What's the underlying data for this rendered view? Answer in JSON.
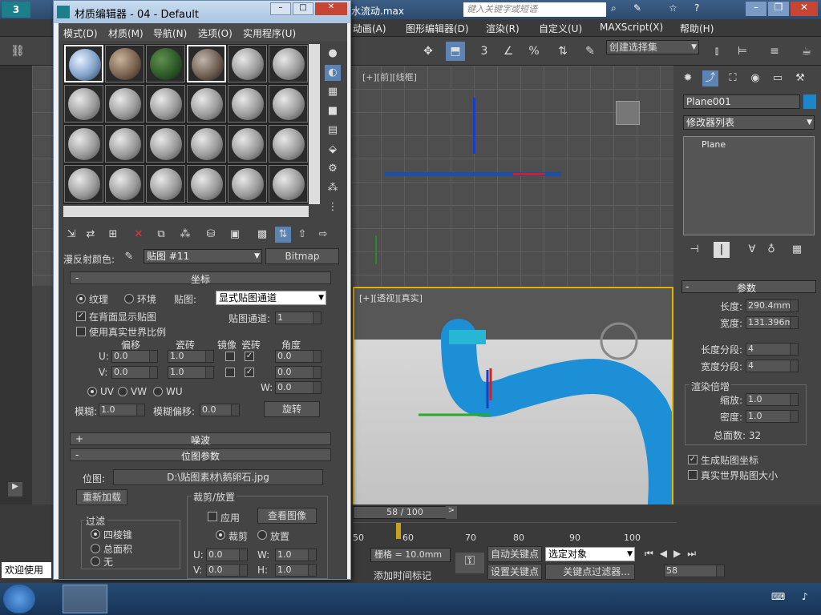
{
  "app": {
    "filename": "水流动.max",
    "search_placeholder": "键入关键字或短语",
    "menu": [
      "动画(A)",
      "图形编辑器(D)",
      "渲染(R)",
      "自定义(U)",
      "MAXScript(X)",
      "帮助(H)"
    ],
    "selection_set": "创建选择集"
  },
  "viewports": {
    "top_label": "[+][前][线框]",
    "persp_label": "[+][透视][真实]"
  },
  "cmdpanel": {
    "object_name": "Plane001",
    "modifier_list": "修改器列表",
    "stack_item": "Plane",
    "params_title": "参数",
    "length_label": "长度:",
    "length_value": "290.4mm",
    "width_label": "宽度:",
    "width_value": "131.396m",
    "length_segs_label": "长度分段:",
    "length_segs_value": "4",
    "width_segs_label": "宽度分段:",
    "width_segs_value": "4",
    "render_mult_label": "渲染倍增",
    "scale_label": "缩放:",
    "scale_value": "1.0",
    "density_label": "密度:",
    "density_value": "1.0",
    "total_faces": "总面数: 32",
    "gen_map_coords": "生成贴图坐标",
    "real_world_map": "真实世界贴图大小"
  },
  "timeline": {
    "frame": "58 / 100",
    "ticks": [
      "50",
      "60",
      "70",
      "80",
      "90",
      "100"
    ],
    "grid": "栅格 = 10.0mm",
    "add_time_tag": "添加时间标记",
    "auto_key": "自动关键点",
    "set_key": "设置关键点",
    "selected_object": "选定对象",
    "key_filter": "关键点过滤器...",
    "current_frame": "58",
    "welcome": "欢迎使用"
  },
  "medit": {
    "title": "材质编辑器 - 04 - Default",
    "menu": [
      "模式(D)",
      "材质(M)",
      "导航(N)",
      "选项(O)",
      "实用程序(U)"
    ],
    "diffuse_label": "漫反射颜色:",
    "map_name": "贴图 #11",
    "map_type": "Bitmap",
    "coords": {
      "title": "坐标",
      "texture": "纹理",
      "environ": "环境",
      "mapping_label": "贴图:",
      "mapping_value": "显式贴图通道",
      "show_back": "在背面显示贴图",
      "map_channel_label": "贴图通道:",
      "map_channel_value": "1",
      "real_world": "使用真实世界比例",
      "offset": "偏移",
      "tiling": "瓷砖",
      "mirror": "镜像",
      "tile": "瓷砖",
      "angle": "角度",
      "u_label": "U:",
      "v_label": "V:",
      "w_label": "W:",
      "u_offset": "0.0",
      "v_offset": "0.0",
      "u_tiling": "1.0",
      "v_tiling": "1.0",
      "u_angle": "0.0",
      "v_angle": "0.0",
      "w_angle": "0.0",
      "uv": "UV",
      "vw": "VW",
      "wu": "WU",
      "blur_label": "模糊:",
      "blur_value": "1.0",
      "blur_offset_label": "模糊偏移:",
      "blur_offset_value": "0.0",
      "rotate": "旋转"
    },
    "noise_title": "噪波",
    "bitmap_params": {
      "title": "位图参数",
      "bitmap_label": "位图:",
      "bitmap_path": "D:\\贴图素材\\鹅卵石.jpg",
      "reload": "重新加载",
      "crop_title": "裁剪/放置",
      "apply": "应用",
      "view_image": "查看图像",
      "crop": "裁剪",
      "place": "放置",
      "filter_title": "过滤",
      "pyramidal": "四棱锥",
      "summed": "总面积",
      "none": "无",
      "u_val": "0.0",
      "v_val": "0.0",
      "w_val": "1.0",
      "h_val": "1.0",
      "w_label": "W:",
      "h_label": "H:"
    }
  }
}
